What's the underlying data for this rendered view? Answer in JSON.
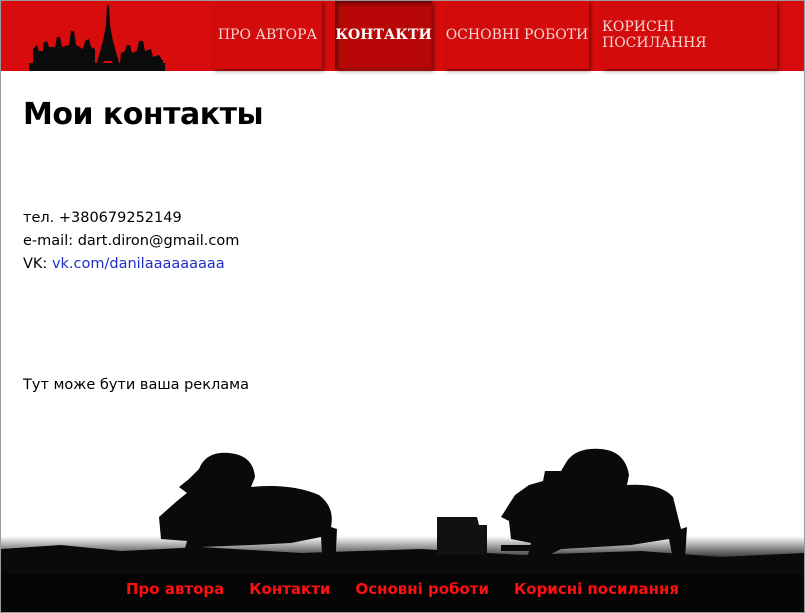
{
  "nav": {
    "items": [
      {
        "label": "ПРО АВТОРА",
        "active": false
      },
      {
        "label": "КОНТАКТИ",
        "active": true
      },
      {
        "label": "ОСНОВНІ РОБОТИ",
        "active": false
      },
      {
        "label": "КОРИСНІ ПОСИЛАННЯ",
        "active": false
      }
    ]
  },
  "page": {
    "title": "Мои контакты",
    "phone": "тел. +380679252149",
    "email": "e-mail: dart.diron@gmail.com",
    "vk_prefix": "VK: ",
    "vk_link": "vk.com/danilaaaaaaaaa",
    "ad_text": "Тут може бути ваша реклама"
  },
  "footer": {
    "links": [
      "Про автора",
      "Контакти",
      "Основні роботи",
      "Корисні посилання"
    ]
  },
  "colors": {
    "header_red": "#d80c0c",
    "link_blue": "#1d2fc4",
    "footer_link_red": "#ff1010"
  }
}
